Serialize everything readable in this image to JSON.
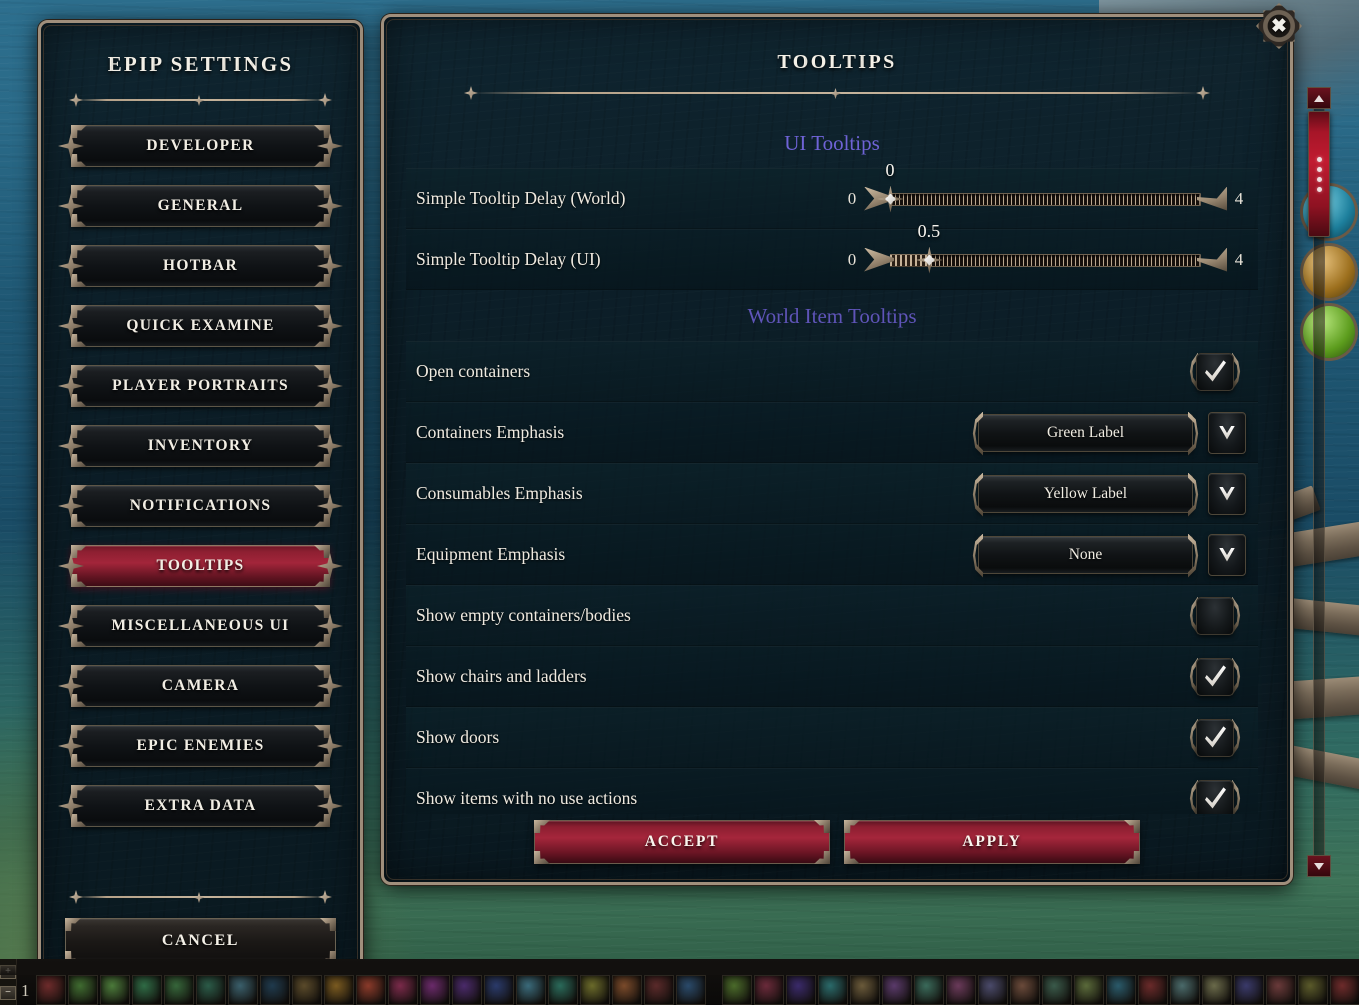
{
  "window": {
    "left_panel_title": "EPIP SETTINGS",
    "right_panel_title": "TOOLTIPS",
    "close_icon": "close-icon"
  },
  "sidebar": {
    "items": [
      {
        "label": "DEVELOPER",
        "selected": false
      },
      {
        "label": "GENERAL",
        "selected": false
      },
      {
        "label": "HOTBAR",
        "selected": false
      },
      {
        "label": "QUICK EXAMINE",
        "selected": false
      },
      {
        "label": "PLAYER PORTRAITS",
        "selected": false
      },
      {
        "label": "INVENTORY",
        "selected": false
      },
      {
        "label": "NOTIFICATIONS",
        "selected": false
      },
      {
        "label": "TOOLTIPS",
        "selected": true
      },
      {
        "label": "MISCELLANEOUS UI",
        "selected": false
      },
      {
        "label": "CAMERA",
        "selected": false
      },
      {
        "label": "EPIC ENEMIES",
        "selected": false
      },
      {
        "label": "EXTRA DATA",
        "selected": false
      }
    ],
    "cancel_label": "CANCEL"
  },
  "sections": [
    {
      "title": "UI Tooltips",
      "color": "#6f63d6",
      "rows": [
        {
          "type": "slider",
          "label": "Simple Tooltip Delay (World)",
          "min": "0",
          "max": "4",
          "value": "0",
          "percent": 0
        },
        {
          "type": "slider",
          "label": "Simple Tooltip Delay (UI)",
          "min": "0",
          "max": "4",
          "value": "0.5",
          "percent": 12.5
        }
      ]
    },
    {
      "title": "World Item Tooltips",
      "color": "#5f54b8",
      "rows": [
        {
          "type": "checkbox",
          "label": "Open containers",
          "checked": true
        },
        {
          "type": "dropdown",
          "label": "Containers Emphasis",
          "value": "Green Label"
        },
        {
          "type": "dropdown",
          "label": "Consumables Emphasis",
          "value": "Yellow Label"
        },
        {
          "type": "dropdown",
          "label": "Equipment Emphasis",
          "value": "None"
        },
        {
          "type": "checkbox",
          "label": "Show empty containers/bodies",
          "checked": false
        },
        {
          "type": "checkbox",
          "label": "Show chairs and ladders",
          "checked": true
        },
        {
          "type": "checkbox",
          "label": "Show doors",
          "checked": true
        },
        {
          "type": "checkbox",
          "label": "Show items with no use actions",
          "checked": true
        }
      ]
    }
  ],
  "actions": {
    "accept_label": "ACCEPT",
    "apply_label": "APPLY"
  },
  "hotbar": {
    "page_number": "1",
    "plus_label": "+",
    "minus_label": "−"
  },
  "colors": {
    "accent_red": "#a5263b",
    "frame_bronze": "#a08f7c",
    "panel_bg": "#0b1c25",
    "text_light": "#f2eee4"
  }
}
